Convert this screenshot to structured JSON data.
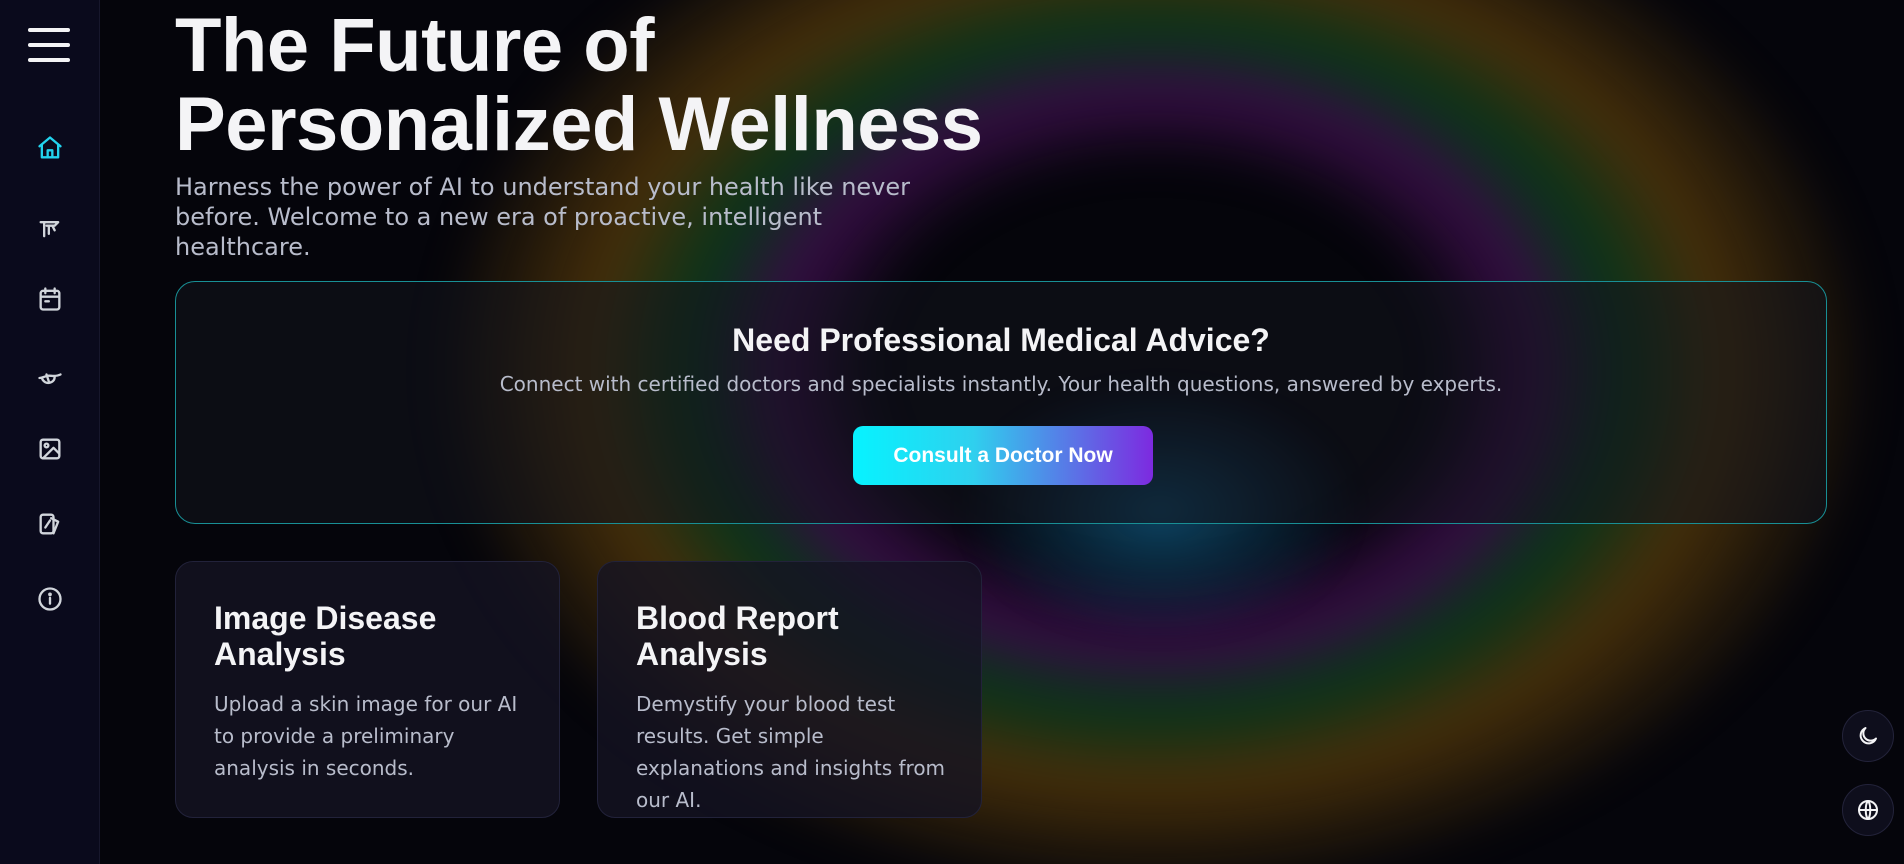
{
  "colors": {
    "accent": "#22d3ee",
    "icon": "#d1d5db",
    "sidebar_bg": "#0a0a1c",
    "card_border": "#188f95",
    "button_gradient_start": "#06f3ff",
    "button_gradient_end": "#7d2ae0"
  },
  "sidebar": {
    "menu_icon": "hamburger-menu-icon",
    "items": [
      {
        "icon": "home-icon",
        "active": true
      },
      {
        "icon": "stethoscope-icon",
        "active": false
      },
      {
        "icon": "calendar-icon",
        "active": false
      },
      {
        "icon": "pill-icon",
        "active": false
      },
      {
        "icon": "image-icon",
        "active": false
      },
      {
        "icon": "report-icon",
        "active": false
      },
      {
        "icon": "info-icon",
        "active": false
      }
    ]
  },
  "hero": {
    "title_line1": "The Future of",
    "title_line2": "Personalized Wellness",
    "subtitle_line1": "Harness the power of AI to understand your health like never",
    "subtitle_line2": "before. Welcome to a new era of proactive, intelligent healthcare."
  },
  "advice": {
    "title": "Need Professional Medical Advice?",
    "description": "Connect with certified doctors and specialists instantly. Your health questions, answered by experts.",
    "button_label": "Consult a Doctor Now"
  },
  "features": [
    {
      "title": "Image Disease Analysis",
      "description": "Upload a skin image for our AI to provide a preliminary analysis in seconds."
    },
    {
      "title": "Blood Report Analysis",
      "description": "Demystify your blood test results. Get simple explanations and insights from our AI."
    }
  ],
  "utility": {
    "theme_icon": "moon-icon",
    "language_icon": "globe-icon"
  }
}
